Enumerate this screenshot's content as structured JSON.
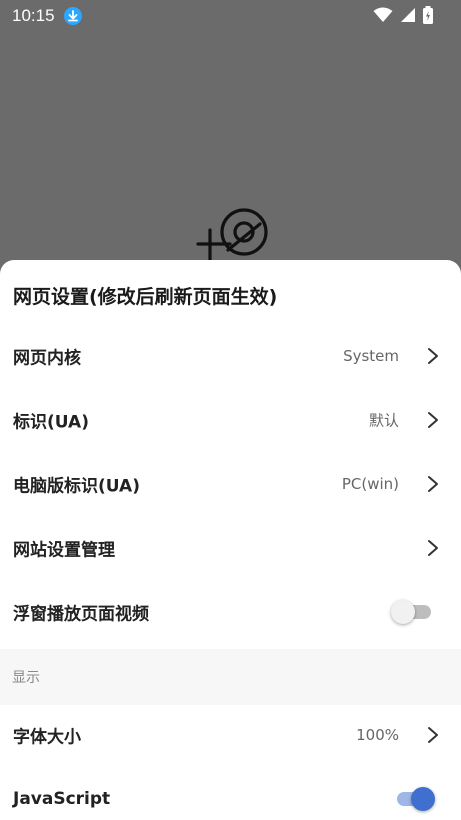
{
  "status_bar": {
    "time": "10:15"
  },
  "sheet": {
    "title": "网页设置(修改后刷新页面生效)",
    "rows": [
      {
        "label": "网页内核",
        "value": "System"
      },
      {
        "label": "标识(UA)",
        "value": "默认"
      },
      {
        "label": "电脑版标识(UA)",
        "value": "PC(win)"
      },
      {
        "label": "网站设置管理",
        "value": ""
      },
      {
        "label": "浮窗播放页面视频",
        "toggle_on": false
      }
    ],
    "section_display": "显示",
    "rows2": [
      {
        "label": "字体大小",
        "value": "100%"
      },
      {
        "label": "JavaScript",
        "toggle_on": true
      }
    ]
  },
  "colors": {
    "accent": "#3f6fcf",
    "download_badge": "#2aa7ff",
    "scrim": "#6b6b6b"
  }
}
